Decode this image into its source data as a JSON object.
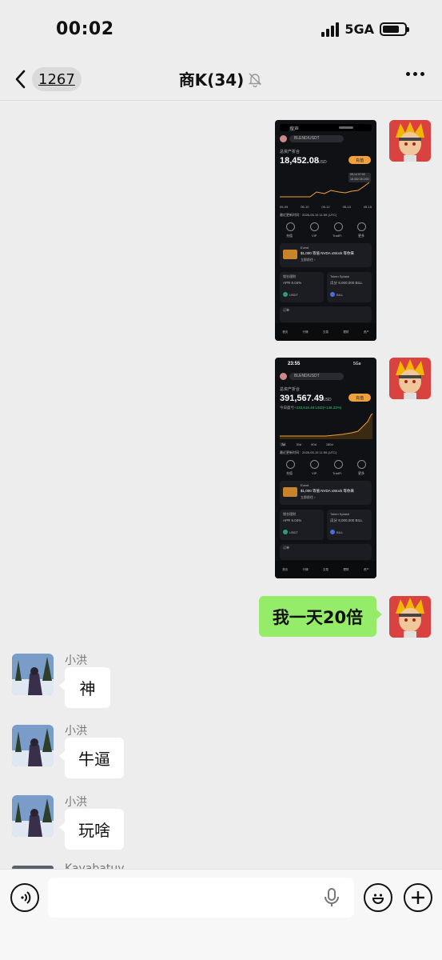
{
  "status_bar": {
    "time": "00:02",
    "network": "5GA"
  },
  "nav": {
    "back_count": "1267",
    "title": "商K(34)"
  },
  "shot1": {
    "top_label": "搜声",
    "search_text": "BLEND/USDT",
    "asset_label": "总资产折合",
    "amount": "18,452.08",
    "unit": "USD",
    "deposit_label": "充值",
    "tooltip_date": "05-14 07:00",
    "tooltip_value": "18,452.08 USD",
    "x_ticks": [
      "05-09",
      "05-10",
      "05-12",
      "05-13",
      "05-15"
    ],
    "update_text": "最近更新时间：2026-05-15 11:59 (UTC)",
    "actions": [
      "充值",
      "VIP",
      "TradFi",
      "更多"
    ],
    "event_title": "Event",
    "event_text": "$1,000 等值 NVDA xStock 等你来",
    "event_link": "立即前往 ›",
    "earn_title": "锁仓理财",
    "earn_apr": "APR 6.04%",
    "earn_coin": "USDT",
    "splash_title": "Token Splash",
    "splash_text": "瓜分 9,000,000 BILL",
    "splash_coin": "BILL",
    "orders_label": "订单",
    "bottom_nav": [
      "首页",
      "行情",
      "交易",
      "理财",
      "资产"
    ]
  },
  "shot2": {
    "time": "23:55",
    "network": "5Ga",
    "search_text": "BLEND/USDT",
    "asset_label": "总资产折合",
    "amount": "391,567.49",
    "unit": "USD",
    "deposit_label": "充值",
    "pnl_label": "今日盈亏",
    "pnl_value": "+233,616.48 USD(+146.22%)",
    "range_tabs": [
      "7d",
      "30d",
      "90d",
      "180d"
    ],
    "update_text": "最近更新时间：2026-05-15 11:59 (UTC)",
    "actions": [
      "充值",
      "VIP",
      "TradFi",
      "更多"
    ],
    "event_title": "Event",
    "event_text": "$1,000 等值 NVDA xStock 等你来",
    "event_link": "立即前往 ›",
    "earn_title": "锁仓理财",
    "earn_apr": "APR 6.04%",
    "earn_coin": "USDT",
    "splash_title": "Token Splash",
    "splash_text": "瓜分 9,000,000 BILL",
    "splash_coin": "BILL",
    "orders_label": "订单",
    "bottom_nav": [
      "首页",
      "行情",
      "交易",
      "理财",
      "资产"
    ]
  },
  "messages": {
    "self_text": "我一天20倍",
    "sender_name": "小洪",
    "reply1": "神",
    "reply2": "牛逼",
    "reply3": "玩啥",
    "next_sender_partial": "Kayabatuy"
  },
  "input": {
    "placeholder": ""
  }
}
